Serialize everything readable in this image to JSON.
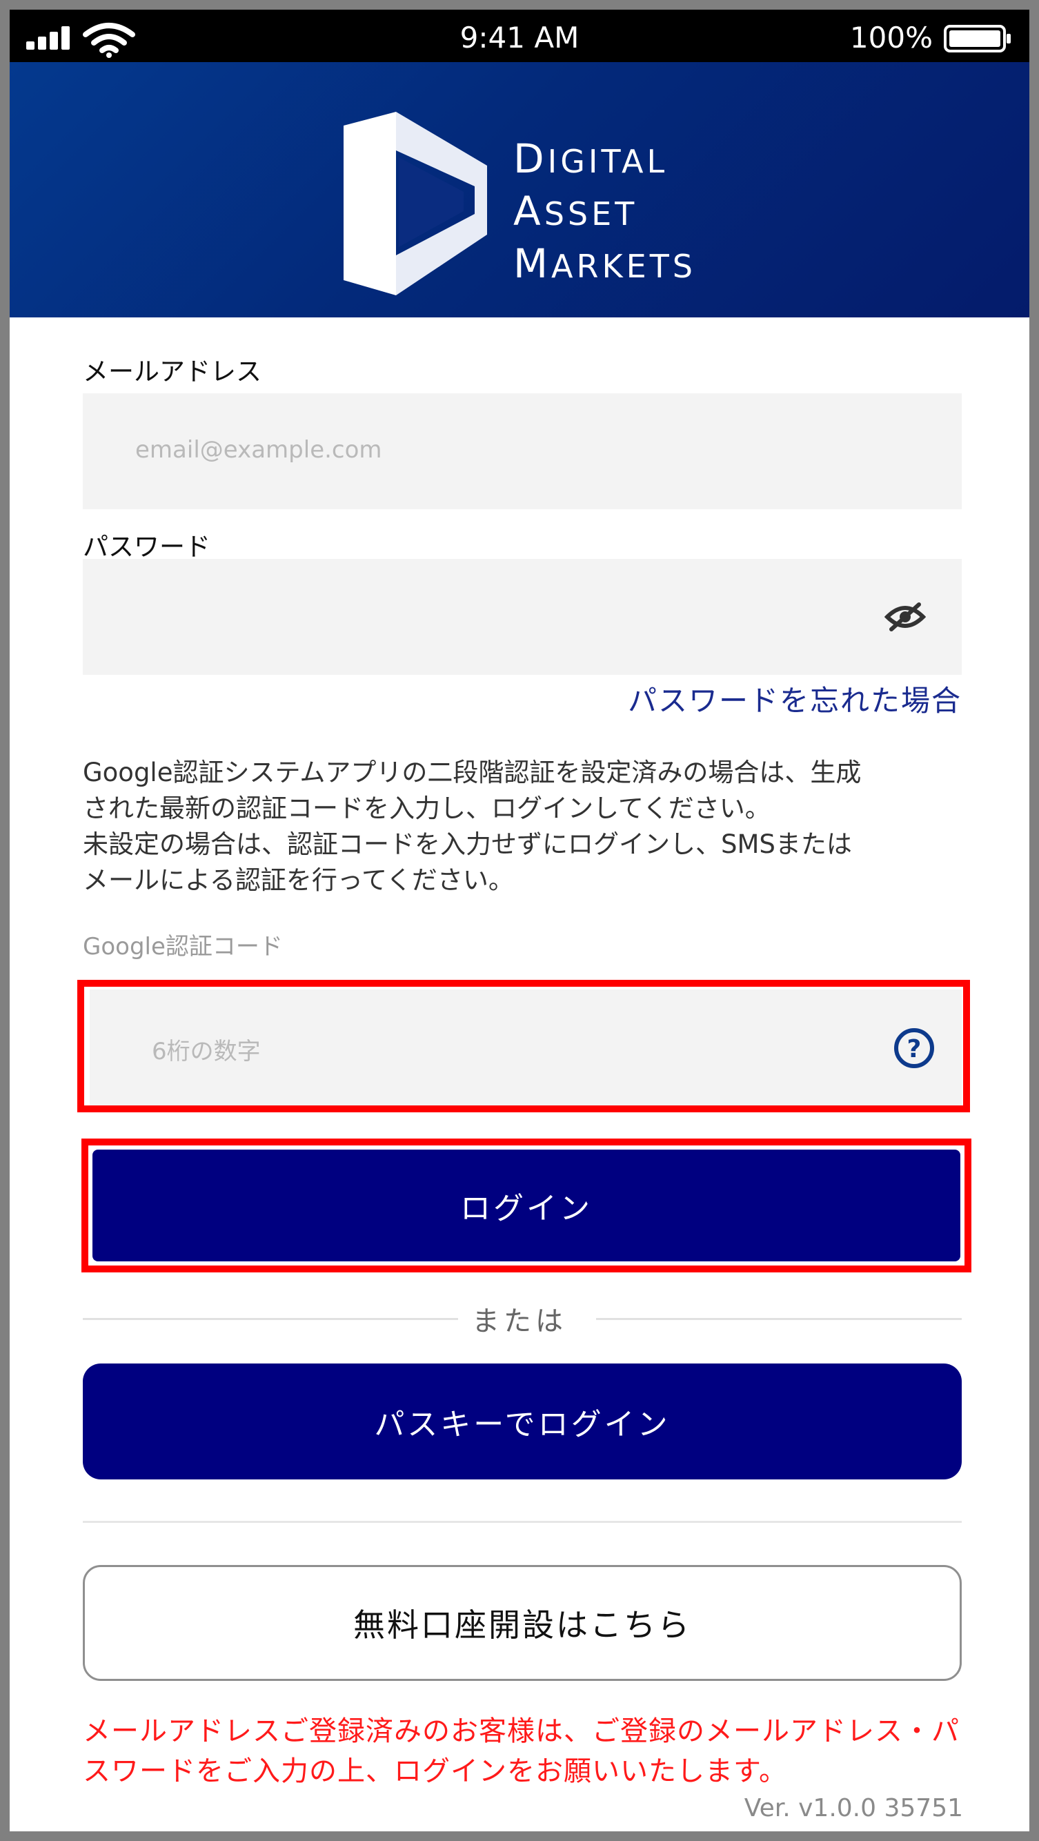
{
  "statusbar": {
    "time": "9:41 AM",
    "battery": "100%"
  },
  "brand": {
    "line1_initial": "D",
    "line1_rest": "IGITAL",
    "line2_initial": "A",
    "line2_rest": "SSET",
    "line3_initial": "M",
    "line3_rest": "ARKETS"
  },
  "form": {
    "email_label": "メールアドレス",
    "email_placeholder": "email@example.com",
    "password_label": "パスワード",
    "forgot_link": "パスワードを忘れた場合",
    "info_line1": "Google認証システムアプリの二段階認証を設定済みの場合は、生成",
    "info_line2": "された最新の認証コードを入力し、ログインしてください。",
    "info_line3": "未設定の場合は、認証コードを入力せずにログインし、SMSまたは",
    "info_line4": "メールによる認証を行ってください。",
    "gauth_label": "Google認証コード",
    "code_placeholder": "6桁の数字",
    "login_button": "ログイン",
    "or_text": "または",
    "passkey_button": "パスキーでログイン",
    "open_account_button": "無料口座開設はこちら",
    "notice_line1": "メールアドレスご登録済みのお客様は、ご登録のメールアドレス・パ",
    "notice_line2": "スワードをご入力の上、ログインをお願いいたします。",
    "version": "Ver. v1.0.0 35751"
  },
  "colors": {
    "primary": "#000080",
    "header_start": "#04398e",
    "header_end": "#041b6b",
    "highlight": "#ff0000",
    "notice": "#ff1a1a",
    "link": "#1a2b8f"
  }
}
